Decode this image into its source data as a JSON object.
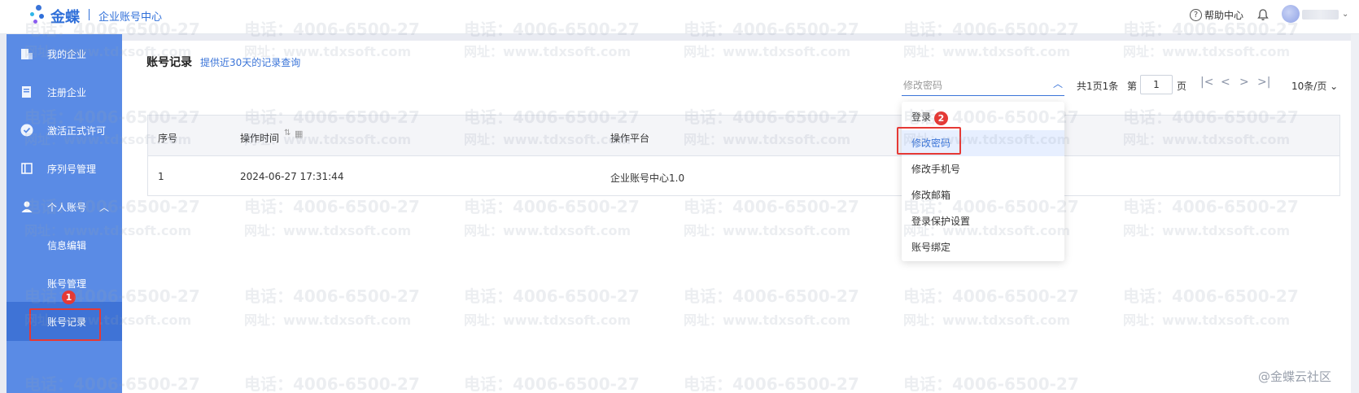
{
  "header": {
    "brand": "金蝶",
    "subtitle": "企业账号中心",
    "help_label": "帮助中心"
  },
  "sidebar": {
    "items": [
      {
        "label": "我的企业",
        "icon": "building-icon"
      },
      {
        "label": "注册企业",
        "icon": "document-icon"
      },
      {
        "label": "激活正式许可",
        "icon": "check-circle-icon"
      },
      {
        "label": "序列号管理",
        "icon": "book-icon"
      },
      {
        "label": "个人账号",
        "icon": "user-icon"
      },
      {
        "label": "信息编辑"
      },
      {
        "label": "账号管理"
      },
      {
        "label": "账号记录"
      }
    ],
    "step_badge": "1"
  },
  "page": {
    "title": "账号记录",
    "hint": "提供近30天的记录查询"
  },
  "filter": {
    "value": "修改密码"
  },
  "pager": {
    "total": "共1页1条",
    "di": "第",
    "page": "1",
    "ye": "页",
    "size": "10条/页"
  },
  "table": {
    "headers": [
      "序号",
      "操作时间",
      "操作平台"
    ],
    "rows": [
      [
        "1",
        "2024-06-27 17:31:44",
        "企业账号中心1.0"
      ]
    ]
  },
  "dropdown": {
    "items": [
      "登录",
      "修改密码",
      "修改手机号",
      "修改邮箱",
      "登录保护设置",
      "账号绑定"
    ],
    "selected": "修改密码",
    "step_badge": "2"
  },
  "watermark": {
    "phone": "电话：4006-6500-27",
    "site": "网址：www.tdxsoft.com"
  },
  "credit": "@金蝶云社区",
  "colors": {
    "sidebar": "#5a8be5",
    "sidebar_active": "#3f73d6",
    "accent": "#3a74d8",
    "highlight": "#e53935"
  }
}
